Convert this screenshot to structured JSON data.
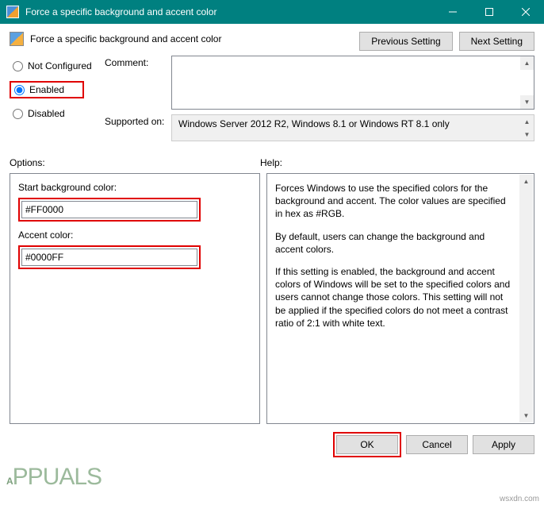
{
  "titlebar": {
    "title": "Force a specific background and accent color"
  },
  "header": {
    "title": "Force a specific background and accent color",
    "previous_btn": "Previous Setting",
    "next_btn": "Next Setting"
  },
  "radio": {
    "not_configured": "Not Configured",
    "enabled": "Enabled",
    "disabled": "Disabled",
    "selected": "enabled"
  },
  "fields": {
    "comment_label": "Comment:",
    "comment_value": "",
    "supported_label": "Supported on:",
    "supported_value": "Windows Server 2012 R2, Windows 8.1 or Windows RT 8.1 only"
  },
  "sections": {
    "options_label": "Options:",
    "help_label": "Help:"
  },
  "options": {
    "bg_label": "Start background color:",
    "bg_value": "#FF0000",
    "accent_label": "Accent color:",
    "accent_value": "#0000FF"
  },
  "help": {
    "p1": "Forces Windows to use the specified colors for the background and accent. The color values are specified in hex as #RGB.",
    "p2": "By default, users can change the background and accent colors.",
    "p3": "If this setting is enabled, the background and accent colors of Windows will be set to the specified colors and users cannot change those colors. This setting will not be applied if the specified colors do not meet a contrast ratio of 2:1 with white text."
  },
  "footer": {
    "ok": "OK",
    "cancel": "Cancel",
    "apply": "Apply"
  },
  "watermark": "APPUALS",
  "wsxdn": "wsxdn.com"
}
